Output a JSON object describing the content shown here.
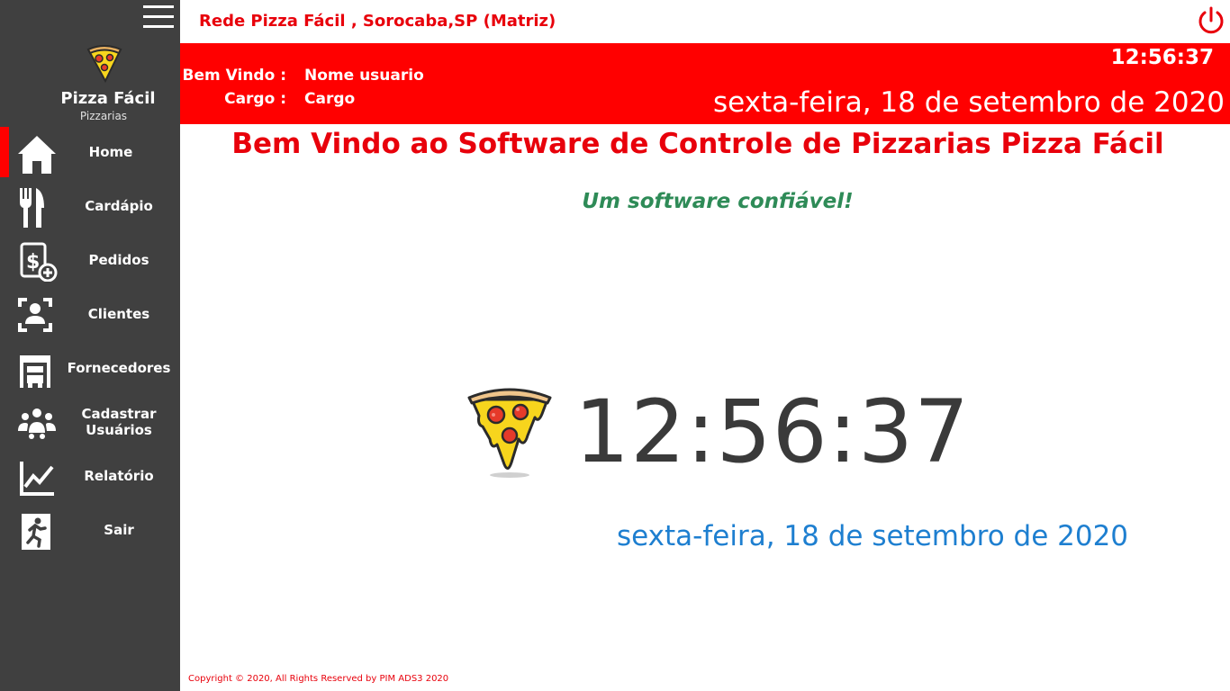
{
  "brand": {
    "name": "Pizza Fácil",
    "subtitle": "Pizzarias"
  },
  "nav": {
    "home": "Home",
    "cardapio": "Cardápio",
    "pedidos": "Pedidos",
    "clientes": "Clientes",
    "fornecedores": "Fornecedores",
    "cadastrar": "Cadastrar Usuários",
    "relatorio": "Relatório",
    "sair": "Sair",
    "active": "home"
  },
  "topbar": {
    "company": "Rede Pizza Fácil , Sorocaba,SP (Matriz)"
  },
  "header": {
    "welcome_label": "Bem Vindo :",
    "welcome_value": "Nome usuario",
    "role_label": "Cargo :",
    "role_value": "Cargo",
    "time": "12:56:37",
    "date": "sexta-feira, 18 de setembro de 2020"
  },
  "main": {
    "title": "Bem Vindo ao Software de Controle de Pizzarias Pizza Fácil",
    "tagline": "Um software confiável!",
    "clock": "12:56:37",
    "date": "sexta-feira, 18 de setembro de 2020"
  },
  "footer": {
    "copyright": "Copyright © 2020, All Rights Reserved by PIM ADS3 2020"
  },
  "colors": {
    "sidebar": "#404040",
    "accent_red": "#ff0000",
    "tagline_green": "#2e8b57",
    "date_blue": "#1e7fd0",
    "clock_dark": "#3a3a3a"
  },
  "icons": [
    "menu-icon",
    "pizza-icon",
    "home-icon",
    "cutlery-icon",
    "order-icon",
    "clients-icon",
    "suppliers-icon",
    "users-icon",
    "chart-icon",
    "exit-icon",
    "power-icon"
  ]
}
